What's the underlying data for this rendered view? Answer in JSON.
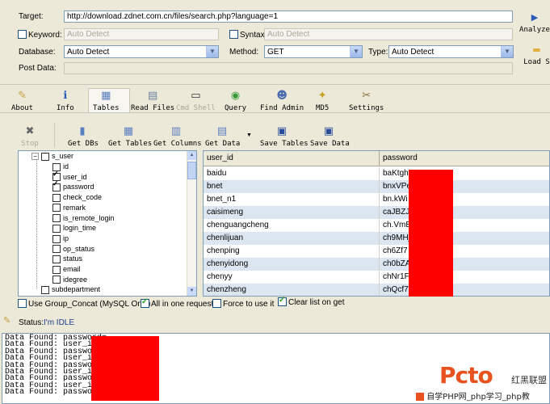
{
  "target": {
    "label": "Target:",
    "value": "http://download.zdnet.com.cn/files/search.php?language=1"
  },
  "keyword": {
    "label": "Keyword:",
    "placeholder": "Auto Detect"
  },
  "syntax": {
    "label": "Syntax:",
    "placeholder": "Auto Detect"
  },
  "database": {
    "label": "Database:",
    "value": "Auto Detect"
  },
  "method": {
    "label": "Method:",
    "value": "GET"
  },
  "type": {
    "label": "Type:",
    "value": "Auto Detect"
  },
  "post_data": {
    "label": "Post Data:"
  },
  "side_buttons": {
    "analyze": "Analyze",
    "load": "Load S"
  },
  "tabs": [
    {
      "label": "About",
      "icon": "pencil-icon"
    },
    {
      "label": "Info",
      "icon": "info-icon"
    },
    {
      "label": "Tables",
      "icon": "table-icon"
    },
    {
      "label": "Read Files",
      "icon": "file-icon"
    },
    {
      "label": "Cmd Shell",
      "icon": "console-icon"
    },
    {
      "label": "Query",
      "icon": "query-icon"
    },
    {
      "label": "Find Admin",
      "icon": "user-icon"
    },
    {
      "label": "MD5",
      "icon": "md5-icon"
    },
    {
      "label": "Settings",
      "icon": "settings-icon"
    }
  ],
  "toolbar": {
    "stop": "Stop",
    "get_dbs": "Get DBs",
    "get_tables": "Get Tables",
    "get_columns": "Get Columns",
    "get_data": "Get Data",
    "save_tables": "Save Tables",
    "save_data": "Save Data"
  },
  "tree": {
    "parent": "s_user",
    "columns": [
      {
        "name": "id",
        "checked": false
      },
      {
        "name": "user_id",
        "checked": true
      },
      {
        "name": "password",
        "checked": true
      },
      {
        "name": "check_code",
        "checked": false
      },
      {
        "name": "remark",
        "checked": false
      },
      {
        "name": "is_remote_login",
        "checked": false
      },
      {
        "name": "login_time",
        "checked": false
      },
      {
        "name": "ip",
        "checked": false
      },
      {
        "name": "op_status",
        "checked": false
      },
      {
        "name": "status",
        "checked": false
      },
      {
        "name": "email",
        "checked": false
      },
      {
        "name": "idegree",
        "checked": false
      }
    ],
    "sibling": "subdepartment"
  },
  "table": {
    "headers": [
      "user_id",
      "password"
    ],
    "rows": [
      [
        "baidu",
        "baKtgh"
      ],
      [
        "bnet",
        "bnxVPe"
      ],
      [
        "bnet_n1",
        "bn.kWi"
      ],
      [
        "caisimeng",
        "caJBZJC"
      ],
      [
        "chenguangcheng",
        "ch.VmE"
      ],
      [
        "chenlijuan",
        "ch9MHj"
      ],
      [
        "chenping",
        "ch6Zf7"
      ],
      [
        "chenyidong",
        "ch0bZA"
      ],
      [
        "chenyy",
        "chNr1Fb"
      ],
      [
        "chenzheng",
        "chQcf7"
      ]
    ]
  },
  "options": {
    "group_concat": "Use Group_Concat (MySQL Only)",
    "all_in_one": "All in one request.",
    "force": "Force to use it",
    "clear_list": "Clear list on get"
  },
  "status": {
    "label": "Status:",
    "value": "I'm IDLE"
  },
  "log_lines": [
    "Data Found: password=",
    "Data Found: user_id=",
    "Data Found: password=",
    "Data Found: user_id=",
    "Data Found: password=",
    "Data Found: user_id=",
    "Data Found: password=",
    "Data Found: user_id=",
    "Data Found: password="
  ],
  "watermark": {
    "brand": "红黑联盟",
    "caption": "自学PHP网_php学习_php教"
  }
}
